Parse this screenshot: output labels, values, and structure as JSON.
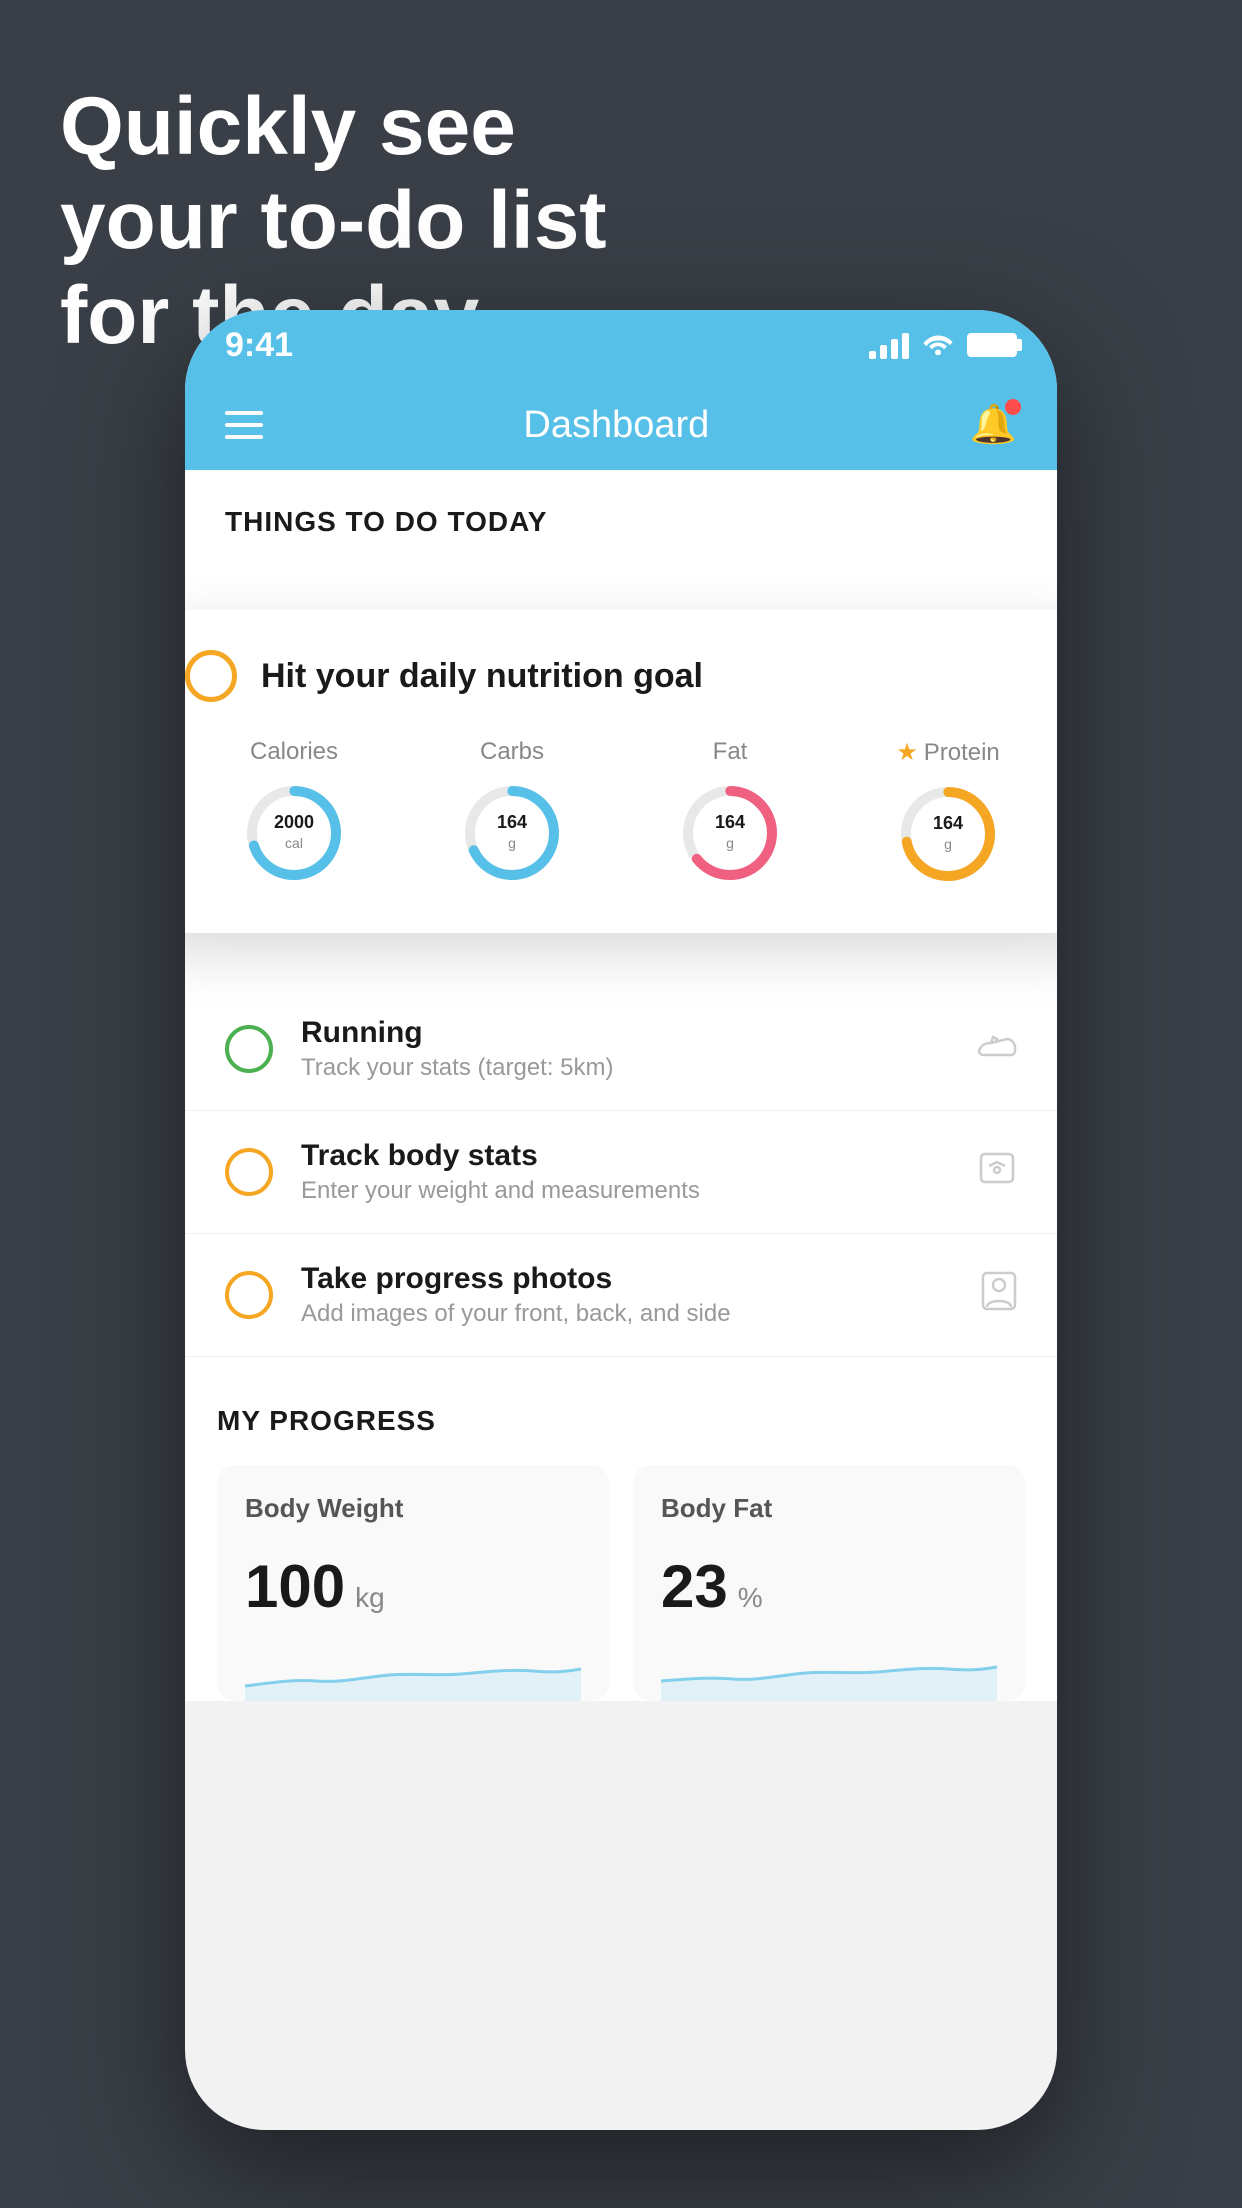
{
  "headline": {
    "line1": "Quickly see",
    "line2": "your to-do list",
    "line3": "for the day."
  },
  "status_bar": {
    "time": "9:41"
  },
  "header": {
    "title": "Dashboard"
  },
  "things_section": {
    "title": "THINGS TO DO TODAY"
  },
  "nutrition_card": {
    "check_label": "circle",
    "title": "Hit your daily nutrition goal",
    "macros": [
      {
        "label": "Calories",
        "value": "2000",
        "unit": "cal",
        "color": "#57c0e8",
        "starred": false
      },
      {
        "label": "Carbs",
        "value": "164",
        "unit": "g",
        "color": "#57c0e8",
        "starred": false
      },
      {
        "label": "Fat",
        "value": "164",
        "unit": "g",
        "color": "#f06080",
        "starred": false
      },
      {
        "label": "Protein",
        "value": "164",
        "unit": "g",
        "color": "#f5a623",
        "starred": true
      }
    ]
  },
  "todo_items": [
    {
      "name": "Running",
      "desc": "Track your stats (target: 5km)",
      "circle_color": "green"
    },
    {
      "name": "Track body stats",
      "desc": "Enter your weight and measurements",
      "circle_color": "orange"
    },
    {
      "name": "Take progress photos",
      "desc": "Add images of your front, back, and side",
      "circle_color": "orange"
    }
  ],
  "progress_section": {
    "title": "MY PROGRESS",
    "cards": [
      {
        "title": "Body Weight",
        "value": "100",
        "unit": "kg"
      },
      {
        "title": "Body Fat",
        "value": "23",
        "unit": "%"
      }
    ]
  }
}
